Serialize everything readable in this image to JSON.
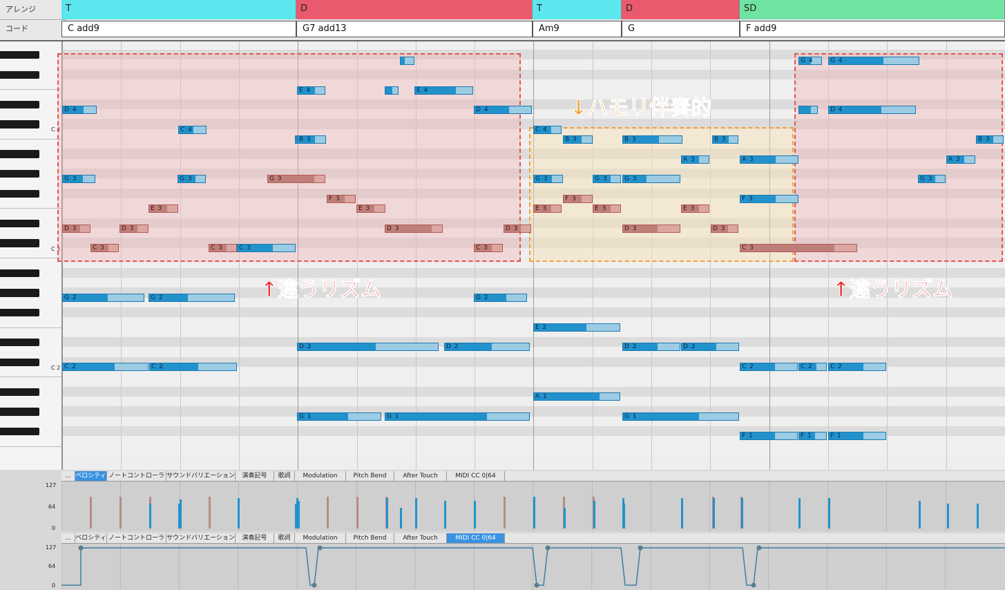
{
  "header": {
    "arrange_label": "アレンジ",
    "chord_label": "コード"
  },
  "arrange": [
    {
      "label": "T",
      "color": "#5ce6ee"
    },
    {
      "label": "D",
      "color": "#ea5a6e"
    },
    {
      "label": "T",
      "color": "#5ce6ee"
    },
    {
      "label": "D",
      "color": "#ea5a6e"
    },
    {
      "label": "SD",
      "color": "#6ee3a2"
    }
  ],
  "chords": [
    "C add9",
    "G7 add13",
    "Am9",
    "G",
    "F add9"
  ],
  "octave_labels": [
    "C 4",
    "C 3",
    "C 2"
  ],
  "notes": [
    {
      "label": "",
      "fill": 0.3
    },
    {
      "label": "E 4",
      "fill": 0.6
    },
    {
      "label": "",
      "fill": 0.5
    },
    {
      "label": "E 4",
      "fill": 0.7
    },
    {
      "label": "D 4",
      "fill": 0.6
    },
    {
      "label": "D 4",
      "fill": 0.6
    },
    {
      "label": "C 4",
      "fill": 0.5
    },
    {
      "label": "B 3",
      "fill": 0.6
    },
    {
      "label": "G 3",
      "fill": 0.6
    },
    {
      "label": "G 3",
      "fill": 0.6
    },
    {
      "label": "E 3",
      "fill": 0.6
    },
    {
      "label": "D 3",
      "fill": 0.6
    },
    {
      "label": "D 3",
      "fill": 0.6
    },
    {
      "label": "C 3",
      "fill": 0.6
    },
    {
      "label": "C 3",
      "fill": 0.6
    },
    {
      "label": "C 3",
      "fill": 0.6
    },
    {
      "label": "B 3",
      "fill": 0.6
    },
    {
      "label": "G 3",
      "fill": 0.8
    },
    {
      "label": "F 3",
      "fill": 0.6
    },
    {
      "label": "E 3",
      "fill": 0.6
    },
    {
      "label": "D 3",
      "fill": 0.8
    },
    {
      "label": "C 3",
      "fill": 0.6
    },
    {
      "label": "D 3",
      "fill": 0.6
    },
    {
      "label": "G 2",
      "fill": 0.55
    },
    {
      "label": "G 2",
      "fill": 0.45
    },
    {
      "label": "G 2",
      "fill": 0.6
    },
    {
      "label": "C 2",
      "fill": 0.6
    },
    {
      "label": "C 2",
      "fill": 0.55
    },
    {
      "label": "D 2",
      "fill": 0.55
    },
    {
      "label": "D 2",
      "fill": 0.55
    },
    {
      "label": "G 1",
      "fill": 0.6
    },
    {
      "label": "G 1",
      "fill": 0.7
    },
    {
      "label": "C 4",
      "fill": 0.6
    },
    {
      "label": "B 3",
      "fill": 0.6
    },
    {
      "label": "B 3",
      "fill": 0.6
    },
    {
      "label": "B 3",
      "fill": 0.6
    },
    {
      "label": "A 3",
      "fill": 0.6
    },
    {
      "label": "G 3",
      "fill": 0.6
    },
    {
      "label": "G 3",
      "fill": 0.6
    },
    {
      "label": "G 3",
      "fill": 0.4
    },
    {
      "label": "F 3",
      "fill": 0.6
    },
    {
      "label": "E 3",
      "fill": 0.6
    },
    {
      "label": "E 3",
      "fill": 0.6
    },
    {
      "label": "E 3",
      "fill": 0.6
    },
    {
      "label": "D 3",
      "fill": 0.6
    },
    {
      "label": "D 3",
      "fill": 0.6
    },
    {
      "label": "E 2",
      "fill": 0.6
    },
    {
      "label": "D 2",
      "fill": 0.6
    },
    {
      "label": "D 2",
      "fill": 0.6
    },
    {
      "label": "A 1",
      "fill": 0.75
    },
    {
      "label": "G 1",
      "fill": 0.65
    },
    {
      "label": "G 4",
      "fill": 0.5
    },
    {
      "label": "G 4",
      "fill": 0.6
    },
    {
      "label": "",
      "fill": 0.6
    },
    {
      "label": "D 4",
      "fill": 0.6
    },
    {
      "label": "A 3",
      "fill": 0.6
    },
    {
      "label": "F 3",
      "fill": 0.6
    },
    {
      "label": "C 3",
      "fill": 0.8
    },
    {
      "label": "B 3",
      "fill": 0.6
    },
    {
      "label": "A 3",
      "fill": 0.6
    },
    {
      "label": "G 3",
      "fill": 0.6
    },
    {
      "label": "C 2",
      "fill": 0.6
    },
    {
      "label": "C 2",
      "fill": 0.6
    },
    {
      "label": "C 2",
      "fill": 0.6
    },
    {
      "label": "F 1",
      "fill": 0.6
    },
    {
      "label": "F 1",
      "fill": 0.55
    },
    {
      "label": "F 1",
      "fill": 0.6
    }
  ],
  "annotations": {
    "rhythm_left": "↑違うリズム",
    "harmony": "↓ハモリ伴奏的",
    "rhythm_right": "↑違うリズム"
  },
  "tabs1": [
    "…",
    "ベロシティ",
    "ノートコントローラー",
    "サウンドバリエーション",
    "演奏記号",
    "歌詞",
    "Modulation",
    "Pitch Bend",
    "After Touch",
    "MIDI CC 0|64"
  ],
  "tabs1_selected": 1,
  "tabs2": [
    "…",
    "ベロシティ",
    "ノートコントローラー",
    "サウンドバリエーション",
    "演奏記号",
    "歌詞",
    "Modulation",
    "Pitch Bend",
    "After Touch",
    "MIDI CC 0|64"
  ],
  "tabs2_selected": 9,
  "velocity_scale": [
    "127",
    "64",
    "0"
  ],
  "cc_scale": [
    "127",
    "64",
    "0"
  ]
}
